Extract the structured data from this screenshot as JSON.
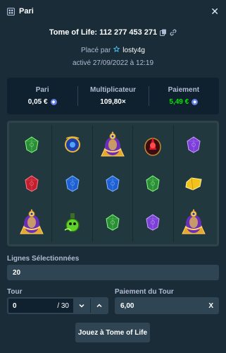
{
  "header": {
    "title": "Pari",
    "icon": "bet-list-icon",
    "close": "✕"
  },
  "game": {
    "title": "Tome of Life: 112 277 453 271"
  },
  "placed": {
    "prefix": "Placé par",
    "user": "losty4g"
  },
  "activated": "activé 27/09/2022 à 12:19",
  "stats": {
    "bet_label": "Pari",
    "bet_value": "0,05 €",
    "mult_label": "Multiplicateur",
    "mult_value": "109,80×",
    "pay_label": "Paiement",
    "pay_value": "5,49 €",
    "pay_color": "#00e701"
  },
  "board": {
    "columns": 5,
    "rows": [
      [
        "green-gem",
        "blue-amulet",
        "pharaoh",
        "red-scarab",
        "purple-gem"
      ],
      [
        "red-gem",
        "blue-gem",
        "blue-gem",
        "green-gem",
        "yellow-gem"
      ],
      [
        "pharaoh",
        "green-potion",
        "green-gem",
        "purple-gem",
        "pharaoh"
      ]
    ]
  },
  "lines": {
    "label": "Lignes Sélectionnées",
    "value": "20"
  },
  "tour": {
    "label": "Tour",
    "value": "0",
    "total": "/ 30"
  },
  "tour_pay": {
    "label": "Paiement du Tour",
    "value": "6,00",
    "clear": "X"
  },
  "play_button": "Jouez à Tome of Life"
}
